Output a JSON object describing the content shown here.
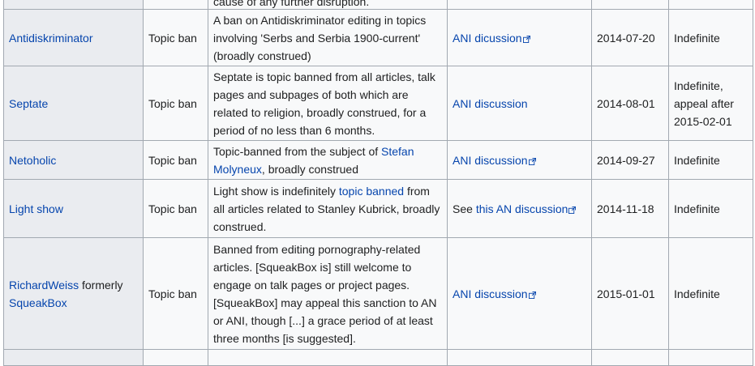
{
  "top_partial": {
    "text": "cause of any further disruption."
  },
  "rows": [
    {
      "user": "Antidiskriminator",
      "sanction": "Topic ban",
      "details": "A ban on Antidiskriminator editing in topics involving 'Serbs and Serbia 1900-current' (broadly construed)",
      "discussion": "ANI dicussion",
      "date": "2014-07-20",
      "expiry": "Indefinite"
    },
    {
      "user": "Septate",
      "sanction": "Topic ban",
      "details": "Septate is topic banned from all articles, talk pages and subpages of both which are related to religion, broadly construed, for a period of no less than 6 months.",
      "discussion": "ANI discussion",
      "date": "2014-08-01",
      "expiry_line1": "Indefinite,",
      "expiry_line2": "appeal after",
      "expiry_line3": "2015-02-01"
    },
    {
      "user": "Netoholic",
      "sanction": "Topic ban",
      "details_pre": "Topic-banned from the subject of",
      "details_link": "Stefan Molyneux",
      "details_post": ", broadly construed",
      "discussion": "ANI discussion",
      "date": "2014-09-27",
      "expiry": "Indefinite"
    },
    {
      "user": "Light show",
      "sanction": "Topic ban",
      "details_pre": "Light show is indefinitely",
      "details_link": "topic banned",
      "details_post": "from all articles related to Stanley Kubrick, broadly construed.",
      "discussion_pre": "See",
      "discussion": "this AN discussion",
      "date": "2014-11-18",
      "expiry": "Indefinite"
    },
    {
      "user": "RichardWeiss",
      "user_middle": "formerly",
      "user_former": "SqueakBox",
      "sanction": "Topic ban",
      "details": "Banned from editing pornography-related articles. [SqueakBox is] still welcome to engage on talk pages or project pages. [SqueakBox] may appeal this sanction to AN or ANI, though [...] a grace period of at least three months [is suggested].",
      "discussion": "ANI discussion",
      "date": "2015-01-01",
      "expiry": "Indefinite"
    }
  ],
  "icons": {
    "external_link": "external-link-icon"
  },
  "colors": {
    "link": "#0645ad",
    "border": "#a2a9b1",
    "user_cell_bg": "#eaecf0",
    "cell_bg": "#f8f9fa"
  }
}
